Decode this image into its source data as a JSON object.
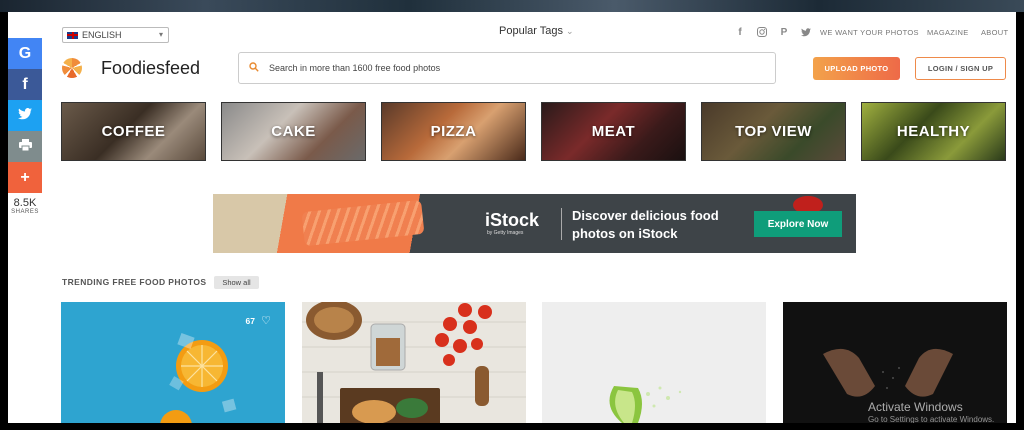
{
  "language": {
    "label": "ENGLISH"
  },
  "header": {
    "popular_tags": "Popular Tags",
    "social_icons": [
      "facebook-icon",
      "instagram-icon",
      "pinterest-icon",
      "twitter-icon"
    ],
    "links": [
      "WE WANT YOUR PHOTOS",
      "MAGAZINE",
      "ABOUT"
    ]
  },
  "brand": {
    "name": "Foodiesfeed",
    "accent": "#f08c3a"
  },
  "search": {
    "placeholder": "Search in more than 1600 free food photos"
  },
  "buttons": {
    "upload": "UPLOAD PHOTO",
    "login": "LOGIN / SIGN UP"
  },
  "share": {
    "buttons": [
      {
        "name": "google",
        "glyph": "G",
        "color": "#4285f4"
      },
      {
        "name": "facebook",
        "glyph": "f",
        "color": "#3b5998"
      },
      {
        "name": "twitter",
        "glyph": "t",
        "color": "#1da1f2"
      },
      {
        "name": "print",
        "glyph": "⎙",
        "color": "#7f8c8d"
      },
      {
        "name": "more",
        "glyph": "+",
        "color": "#f0623c"
      }
    ],
    "count": "8.5K",
    "count_label": "SHARES"
  },
  "categories": [
    "COFFEE",
    "CAKE",
    "PIZZA",
    "MEAT",
    "TOP VIEW",
    "HEALTHY"
  ],
  "banner": {
    "brand": "iStock",
    "brand_sub": "by Getty Images",
    "line1": "Discover delicious food",
    "line2": "photos on iStock",
    "cta": "Explore Now"
  },
  "trending": {
    "title": "TRENDING FREE FOOD PHOTOS",
    "show_all": "Show all",
    "likes": "67"
  },
  "watermark": {
    "line1": "Activate Windows",
    "line2": "Go to Settings to activate Windows."
  }
}
